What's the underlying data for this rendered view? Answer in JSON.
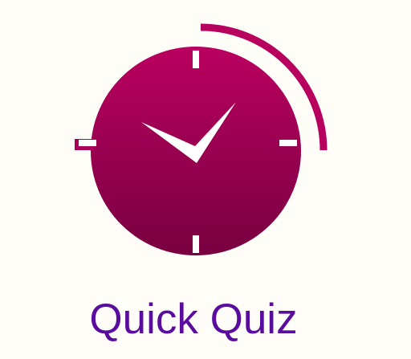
{
  "title": "Quick Quiz",
  "icon": "clock-icon",
  "colors": {
    "clock_top": "#ba0060",
    "clock_bottom": "#780040",
    "title": "#5a0c9e",
    "background": "#fefdf8"
  }
}
